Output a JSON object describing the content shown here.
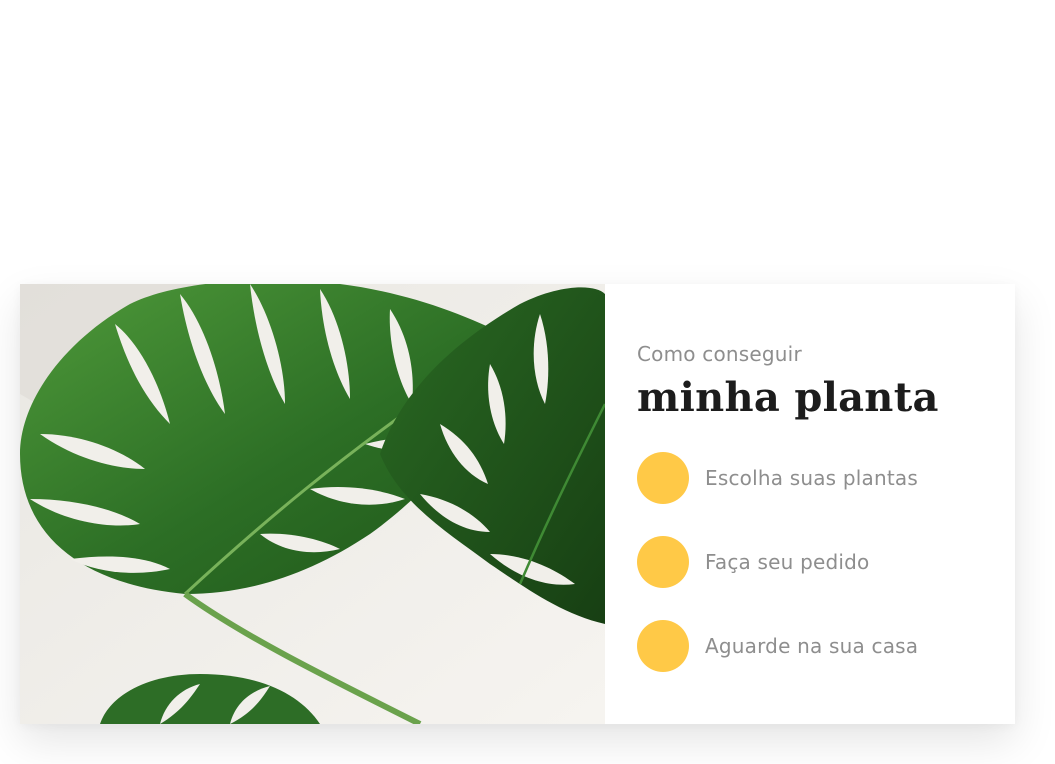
{
  "section": {
    "kicker": "Como conseguir",
    "headline": "minha planta",
    "steps": [
      {
        "label": "Escolha suas plantas"
      },
      {
        "label": "Faça seu pedido"
      },
      {
        "label": "Aguarde na sua casa"
      }
    ]
  },
  "colors": {
    "accent": "#ffc947",
    "text_muted": "#8e8e8e",
    "text_dark": "#1c1c1c",
    "photo_background": "#f1efea",
    "leaf_green": "#2f7a2a"
  },
  "image": {
    "icon": "monstera-leaf-photo"
  }
}
